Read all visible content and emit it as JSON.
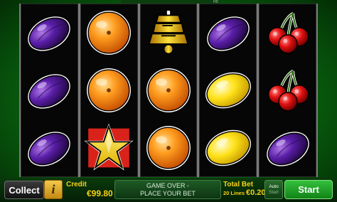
{
  "top_tag": "HD",
  "reels": [
    [
      "plum",
      "plum",
      "plum"
    ],
    [
      "orange",
      "orange",
      "star"
    ],
    [
      "bell",
      "orange",
      "orange"
    ],
    [
      "plum",
      "lemon",
      "lemon"
    ],
    [
      "cherry",
      "cherry",
      "plum"
    ]
  ],
  "controls": {
    "collect_label": "Collect",
    "info_label": "i",
    "credit_label": "Credit",
    "credit_value": "€99.80",
    "message_line1": "GAME OVER -",
    "message_line2": "PLACE YOUR BET",
    "total_bet_label": "Total Bet",
    "lines_label": "20 Lines",
    "total_bet_value": "€0.20",
    "auto_label": "Auto",
    "auto_sub": "Start",
    "start_label": "Start"
  },
  "colors": {
    "accent_yellow": "#f7d117",
    "start_green": "#1fa326",
    "background_green": "#0a6a12"
  }
}
